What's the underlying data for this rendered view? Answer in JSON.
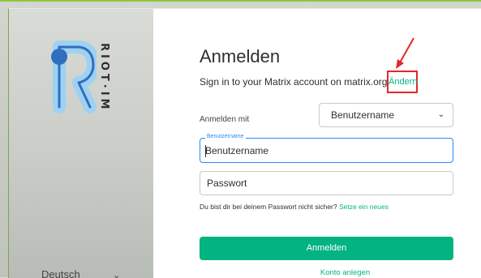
{
  "brand": {
    "wordmark": "RIOT·IM"
  },
  "login": {
    "title": "Anmelden",
    "subtitle": "Sign in to your Matrix account on matrix.org",
    "change_link": "Ändern",
    "login_with_label": "Anmelden mit",
    "login_with_value": "Benutzername",
    "username_label": "Benutzername",
    "username_placeholder": "Benutzername",
    "password_placeholder": "Passwort",
    "forgot_text": "Du bist dir bei deinem Passwort nicht sicher?",
    "forgot_link": "Setze ein neues",
    "submit_label": "Anmelden",
    "register_link": "Konto anlegen"
  },
  "language": {
    "value": "Deutsch"
  },
  "colors": {
    "accent": "#03b381",
    "focus": "#238cf5",
    "highlight": "#e0292b"
  }
}
